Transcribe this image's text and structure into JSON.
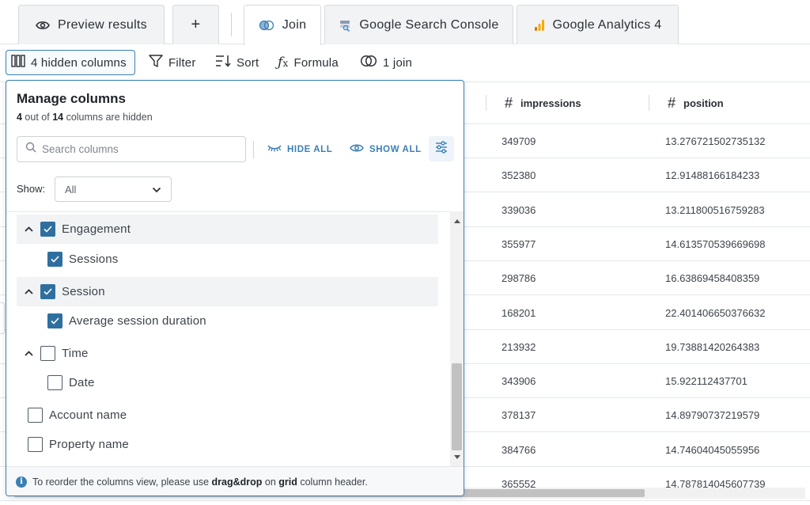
{
  "tabs": [
    {
      "label": "Preview results",
      "icon": "eye-icon",
      "active": false
    },
    {
      "label": "+",
      "icon": "plus",
      "active": false
    },
    {
      "label": "Join",
      "icon": "join-icon",
      "active": true
    },
    {
      "label": "Google Search Console",
      "icon": "search-console-icon",
      "active": false
    },
    {
      "label": "Google Analytics 4",
      "icon": "analytics-icon",
      "active": false
    }
  ],
  "toolbar": {
    "hidden_columns": "4 hidden columns",
    "filter": "Filter",
    "sort": "Sort",
    "formula": "Formula",
    "join": "1 join"
  },
  "grid": {
    "columns": [
      {
        "name": "impressions"
      },
      {
        "name": "position"
      }
    ],
    "rows": [
      [
        "349709",
        "13.276721502735132"
      ],
      [
        "352380",
        "12.91488166184233"
      ],
      [
        "339036",
        "13.211800516759283"
      ],
      [
        "355977",
        "14.613570539669698"
      ],
      [
        "298786",
        "16.63869458408359"
      ],
      [
        "168201",
        "22.401406650376632"
      ],
      [
        "213932",
        "19.73881420264383"
      ],
      [
        "343906",
        "15.922112437701"
      ],
      [
        "378137",
        "14.89790737219579"
      ],
      [
        "384766",
        "14.74604045055956"
      ],
      [
        "365552",
        "14.787814045607739"
      ]
    ]
  },
  "panel": {
    "title": "Manage columns",
    "subtitle": {
      "hidden": "4",
      "text1": " out of ",
      "total": "14",
      "text2": " columns are hidden"
    },
    "search_placeholder": "Search columns",
    "hide_all": "HIDE ALL",
    "show_all": "SHOW ALL",
    "show_label": "Show:",
    "show_value": "All",
    "items": [
      {
        "label": "Engagement",
        "checked": true,
        "group": true,
        "expanded": true
      },
      {
        "label": "Sessions",
        "checked": true,
        "group": false
      },
      {
        "label": "Session",
        "checked": true,
        "group": true,
        "expanded": true
      },
      {
        "label": "Average session duration",
        "checked": true,
        "group": false
      },
      {
        "label": "Time",
        "checked": false,
        "group": true,
        "expanded": true
      },
      {
        "label": "Date",
        "checked": false,
        "group": false
      },
      {
        "label": "Account name",
        "checked": false,
        "group": false,
        "root": true
      },
      {
        "label": "Property name",
        "checked": false,
        "group": false,
        "root": true
      }
    ],
    "footer": {
      "text1": "To reorder the columns view, please use ",
      "b1": "drag&drop",
      "text2": " on ",
      "b2": "grid",
      "text3": " column header."
    }
  }
}
